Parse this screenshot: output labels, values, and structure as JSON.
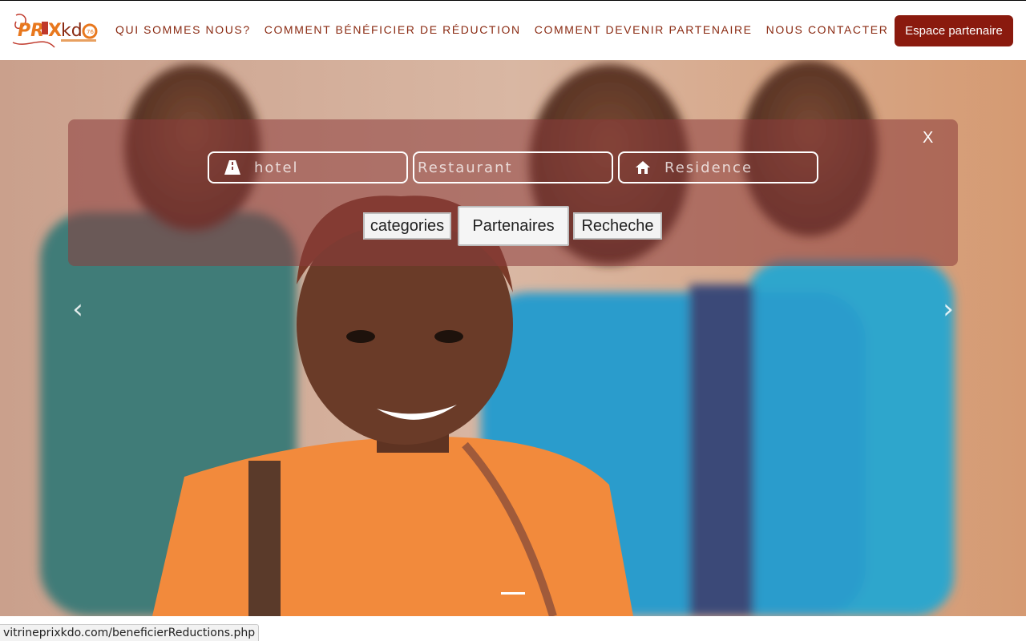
{
  "header": {
    "logo_text": "prixkdo",
    "nav": [
      {
        "label": "QUI SOMMES NOUS?"
      },
      {
        "label": "COMMENT BÉNÉFICIER DE RÉDUCTION"
      },
      {
        "label": "COMMENT DEVENIR PARTENAIRE"
      },
      {
        "label": "NOUS CONTACTER"
      }
    ],
    "partner_button": "Espace partenaire"
  },
  "search": {
    "close_label": "X",
    "fields": [
      {
        "placeholder": "hotel",
        "icon": "road-icon"
      },
      {
        "placeholder": "Restaurant",
        "icon": ""
      },
      {
        "placeholder": "Residence",
        "icon": "home-icon"
      }
    ],
    "tabs": [
      {
        "label": "categories"
      },
      {
        "label": "Partenaires"
      },
      {
        "label": "Recheche"
      }
    ]
  },
  "carousel": {
    "prev": "‹",
    "next": "›"
  },
  "status_bar": {
    "url": "vitrineprixkdo.com/beneficierReductions.php"
  },
  "colors": {
    "brand": "#8a1a0e",
    "nav_text": "#8a2a12",
    "logo_orange": "#f08a24"
  }
}
